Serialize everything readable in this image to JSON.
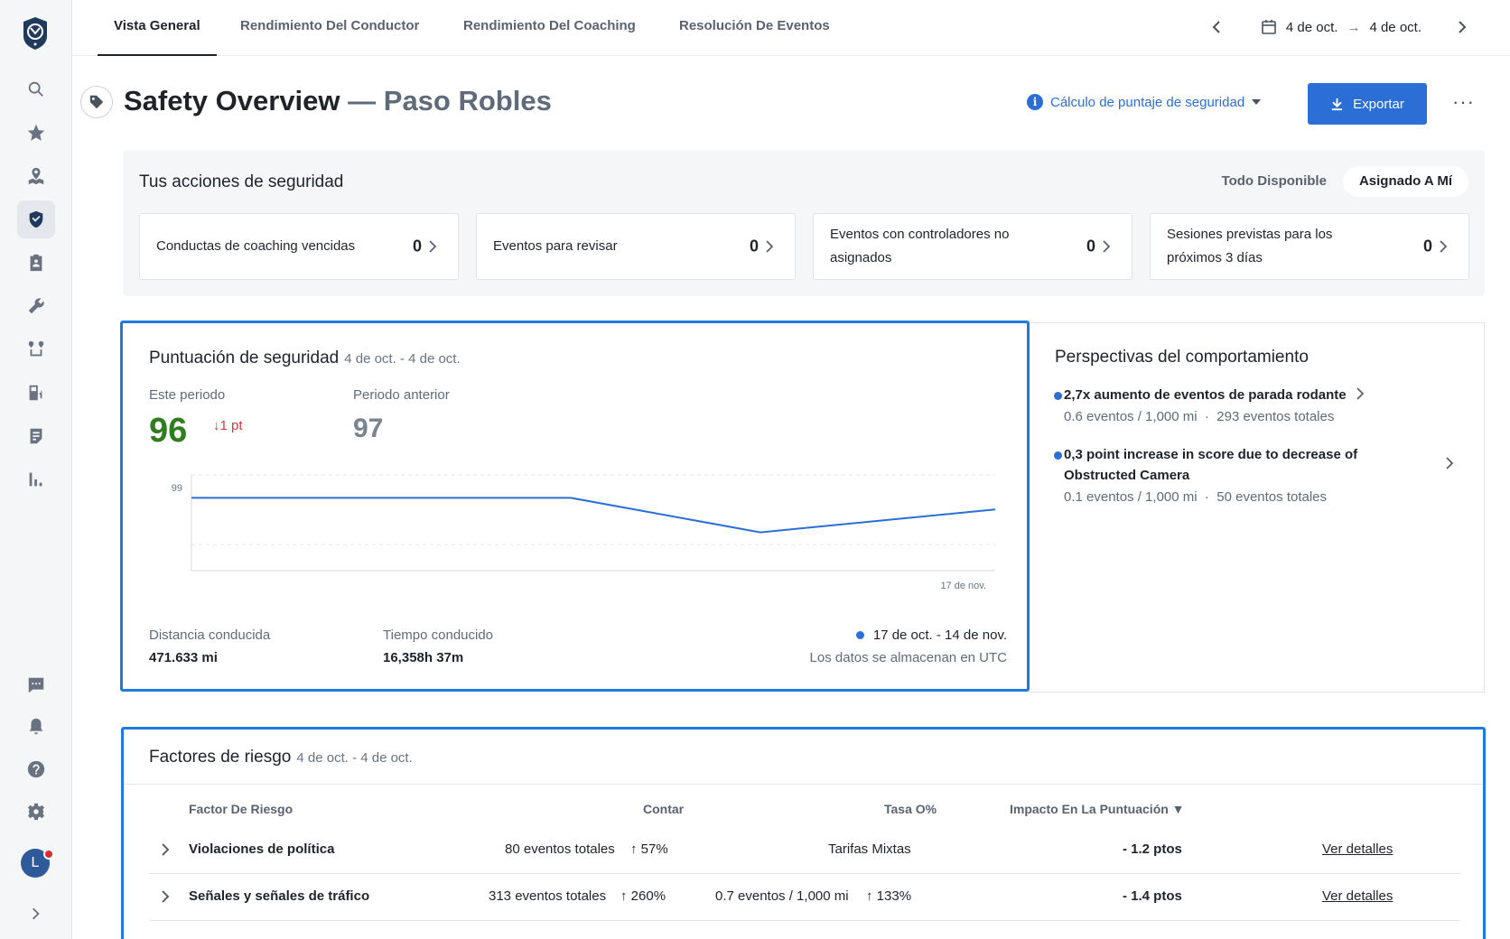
{
  "nav": {
    "tabs": [
      {
        "label": "Vista General",
        "active": true
      },
      {
        "label": "Rendimiento Del Conductor"
      },
      {
        "label": "Rendimiento Del Coaching"
      },
      {
        "label": "Resolución De Eventos"
      }
    ],
    "date_start": "4 de oct.",
    "date_end": "4 de oct."
  },
  "sidebar": {
    "avatar_initial": "L",
    "items": [
      "search-icon",
      "star-icon",
      "map-icon",
      "shield-icon",
      "clipboard-icon",
      "wrench-icon",
      "route-icon",
      "fuel-icon",
      "document-icon",
      "bar-chart-icon",
      "chat-icon",
      "bell-icon",
      "help-icon",
      "gear-icon",
      "expand-icon"
    ]
  },
  "header": {
    "title": "Safety Overview",
    "subtitle": "— Paso Robles",
    "calc_link": "Cálculo de puntaje de seguridad",
    "export_label": "Exportar",
    "more_label": "···"
  },
  "actions": {
    "title": "Tus acciones de seguridad",
    "filters": [
      "Todo Disponible",
      "Asignado A Mí"
    ],
    "active_filter": "Asignado A Mí",
    "cards": [
      {
        "label": "Conductas de coaching vencidas",
        "count": "0"
      },
      {
        "label": "Eventos para revisar",
        "count": "0"
      },
      {
        "label": "Eventos con controladores no asignados",
        "count": "0"
      },
      {
        "label": "Sesiones previstas para los próximos 3 días",
        "count": "0"
      }
    ]
  },
  "score": {
    "title": "Puntuación de seguridad",
    "range": "4 de oct. - 4 de oct.",
    "this_period_label": "Este periodo",
    "this_period_value": "96",
    "delta": "1 pt",
    "prev_period_label": "Periodo anterior",
    "prev_period_value": "97",
    "distance_label": "Distancia conducida",
    "distance_value": "471.633 mi",
    "time_label": "Tiempo conducido",
    "time_value": "16,358h 37m",
    "legend": "17 de oct. - 14 de nov.",
    "utc_note": "Los datos se almacenan en UTC"
  },
  "chart_data": {
    "type": "line",
    "y_tick_labels": [
      "99"
    ],
    "x_tick_labels": [
      "17 de nov."
    ],
    "series": [
      {
        "values": [
          98.4,
          98.4,
          97.5,
          98.1
        ],
        "color": "#2b6fd6"
      }
    ],
    "x": [
      "start",
      "mid",
      "low",
      "end"
    ],
    "ylim": [
      96.5,
      99
    ],
    "grid": true
  },
  "insights": {
    "title": "Perspectivas del comportamiento",
    "items": [
      {
        "headline": "2,7x aumento de eventos de parada rodante",
        "rate": "0.6 eventos / 1,000 mi",
        "total": "293 eventos totales"
      },
      {
        "headline": "0,3 point increase in score due to decrease of Obstructed Camera",
        "rate": "0.1 eventos / 1,000 mi",
        "total": "50 eventos totales"
      }
    ]
  },
  "risk": {
    "title": "Factores de riesgo",
    "range": "4 de oct. - 4 de oct.",
    "columns": [
      "Factor De Riesgo",
      "Contar",
      "Tasa O%",
      "Impacto En La Puntuación ▼"
    ],
    "rows": [
      {
        "factor": "Violaciones de política",
        "count": "80 eventos totales",
        "count_change": "57%",
        "rate": "Tarifas Mixtas",
        "rate_change": "",
        "impact": "- 1.2 ptos",
        "link": "Ver detalles"
      },
      {
        "factor": "Señales y señales de tráfico",
        "count": "313 eventos totales",
        "count_change": "260%",
        "rate": "0.7 eventos / 1,000 mi",
        "rate_change": "133%",
        "impact": "- 1.4 ptos",
        "link": "Ver detalles"
      }
    ]
  },
  "colors": {
    "accent": "#2b6fd6",
    "highlight": "#1f7ae0",
    "good": "#2f7d1f",
    "bad": "#d23b3b"
  }
}
